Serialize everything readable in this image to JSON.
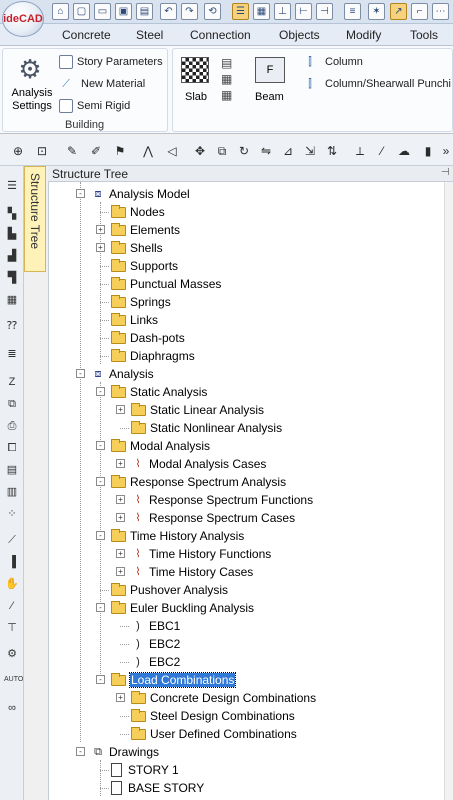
{
  "app": {
    "logo_text": "ideCAD"
  },
  "ribbon_tabs": [
    "Concrete",
    "Steel",
    "Connection",
    "Objects",
    "Modify",
    "Tools"
  ],
  "ribbon": {
    "analysis_settings": "Analysis\nSettings",
    "story_parameters": "Story Parameters",
    "new_material": "New Material",
    "semi_rigid": "Semi Rigid",
    "group_building": "Building",
    "slab": "Slab",
    "beam": "Beam",
    "column": "Column",
    "column_shearwall": "Column/Shearwall Punchi"
  },
  "panel": {
    "title": "Structure Tree",
    "vertical_tab": "Structure Tree"
  },
  "tree": [
    {
      "label": "Analysis Model",
      "level": 0,
      "expander": "-",
      "icon": "model"
    },
    {
      "label": "Nodes",
      "level": 1,
      "expander": "",
      "icon": "folder"
    },
    {
      "label": "Elements",
      "level": 1,
      "expander": "+",
      "icon": "folder"
    },
    {
      "label": "Shells",
      "level": 1,
      "expander": "+",
      "icon": "folder"
    },
    {
      "label": "Supports",
      "level": 1,
      "expander": "",
      "icon": "folder"
    },
    {
      "label": "Punctual Masses",
      "level": 1,
      "expander": "",
      "icon": "folder"
    },
    {
      "label": "Springs",
      "level": 1,
      "expander": "",
      "icon": "folder"
    },
    {
      "label": "Links",
      "level": 1,
      "expander": "",
      "icon": "folder"
    },
    {
      "label": "Dash-pots",
      "level": 1,
      "expander": "",
      "icon": "folder"
    },
    {
      "label": "Diaphragms",
      "level": 1,
      "expander": "",
      "icon": "folder"
    },
    {
      "label": "Analysis",
      "level": 0,
      "expander": "-",
      "icon": "model"
    },
    {
      "label": "Static Analysis",
      "level": 1,
      "expander": "-",
      "icon": "folder"
    },
    {
      "label": "Static Linear Analysis",
      "level": 2,
      "expander": "+",
      "icon": "folder"
    },
    {
      "label": "Static Nonlinear Analysis",
      "level": 2,
      "expander": "",
      "icon": "folder"
    },
    {
      "label": "Modal Analysis",
      "level": 1,
      "expander": "-",
      "icon": "folder"
    },
    {
      "label": "Modal Analysis Cases",
      "level": 2,
      "expander": "+",
      "icon": "case"
    },
    {
      "label": "Response Spectrum Analysis",
      "level": 1,
      "expander": "-",
      "icon": "folder"
    },
    {
      "label": "Response Spectrum Functions",
      "level": 2,
      "expander": "+",
      "icon": "case"
    },
    {
      "label": "Response Spectrum Cases",
      "level": 2,
      "expander": "+",
      "icon": "case"
    },
    {
      "label": "Time History Analysis",
      "level": 1,
      "expander": "-",
      "icon": "folder"
    },
    {
      "label": "Time History Functions",
      "level": 2,
      "expander": "+",
      "icon": "case"
    },
    {
      "label": "Time History Cases",
      "level": 2,
      "expander": "+",
      "icon": "case"
    },
    {
      "label": "Pushover Analysis",
      "level": 1,
      "expander": "",
      "icon": "folder"
    },
    {
      "label": "Euler Buckling Analysis",
      "level": 1,
      "expander": "-",
      "icon": "folder"
    },
    {
      "label": "EBC1",
      "level": 2,
      "expander": "",
      "icon": "curve"
    },
    {
      "label": "EBC2",
      "level": 2,
      "expander": "",
      "icon": "curve"
    },
    {
      "label": "EBC2",
      "level": 2,
      "expander": "",
      "icon": "curve"
    },
    {
      "label": "Load Combinations",
      "level": 1,
      "expander": "-",
      "icon": "folder",
      "selected": true
    },
    {
      "label": "Concrete Design Combinations",
      "level": 2,
      "expander": "+",
      "icon": "folder"
    },
    {
      "label": "Steel Design Combinations",
      "level": 2,
      "expander": "",
      "icon": "folder"
    },
    {
      "label": "User Defined Combinations",
      "level": 2,
      "expander": "",
      "icon": "folder"
    },
    {
      "label": "Drawings",
      "level": 0,
      "expander": "-",
      "icon": "drawings"
    },
    {
      "label": "STORY 1",
      "level": 1,
      "expander": "",
      "icon": "doc"
    },
    {
      "label": "BASE STORY",
      "level": 1,
      "expander": "",
      "icon": "doc"
    }
  ]
}
